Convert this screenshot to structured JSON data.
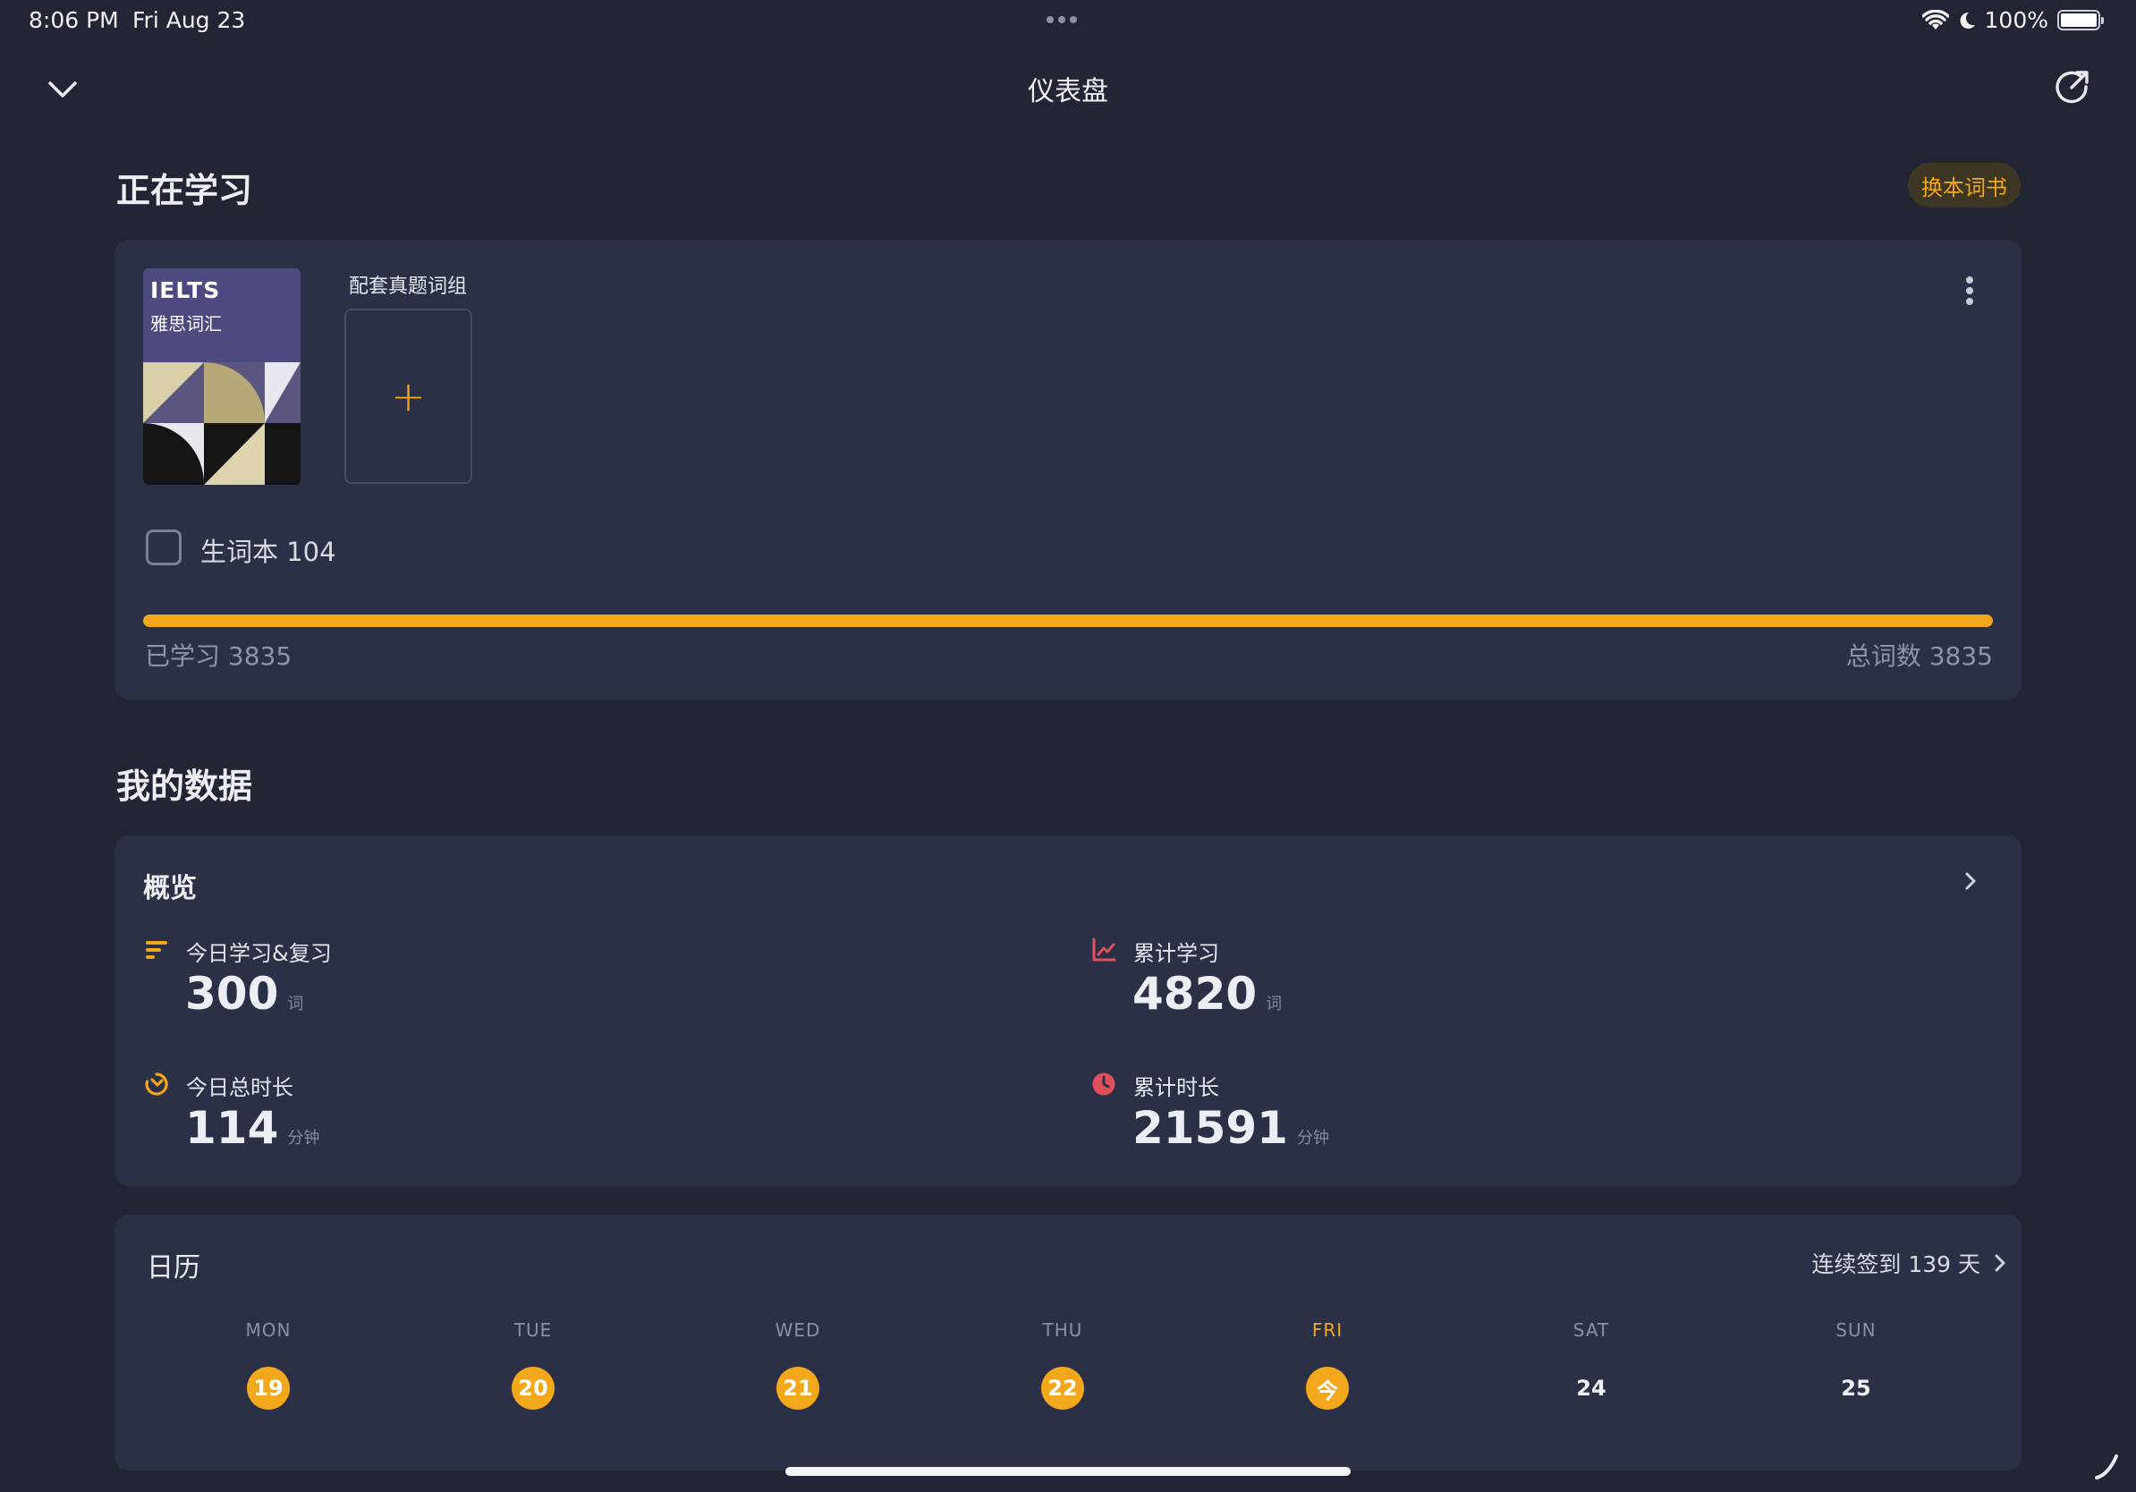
{
  "status_bar": {
    "time": "8:06 PM",
    "date": "Fri Aug 23",
    "battery": "100%"
  },
  "header": {
    "title": "仪表盘"
  },
  "learning": {
    "section_title": "正在学习",
    "switch_book_label": "换本词书",
    "book": {
      "cover_title": "IELTS",
      "cover_subtitle": "雅思词汇"
    },
    "match_group_label": "配套真题词组",
    "add_symbol": "+",
    "vocab_book_label": "生词本 104",
    "progress": {
      "learned_label": "已学习 3835",
      "total_label": "总词数 3835",
      "learned": 3835,
      "total": 3835
    }
  },
  "my_data": {
    "section_title": "我的数据",
    "overview": {
      "title": "概览",
      "stats": [
        {
          "label": "今日学习&复习",
          "value": "300",
          "unit": "词",
          "icon": "bars-icon",
          "color": "#f3a81b"
        },
        {
          "label": "累计学习",
          "value": "4820",
          "unit": "词",
          "icon": "line-chart-icon",
          "color": "#e0505a"
        },
        {
          "label": "今日总时长",
          "value": "114",
          "unit": "分钟",
          "icon": "timer-icon",
          "color": "#f3a81b"
        },
        {
          "label": "累计时长",
          "value": "21591",
          "unit": "分钟",
          "icon": "clock-icon",
          "color": "#e0505a"
        }
      ]
    },
    "calendar": {
      "title": "日历",
      "streak_label": "连续签到 139 天",
      "days": [
        {
          "dow": "MON",
          "date": "19",
          "done": true,
          "today": false
        },
        {
          "dow": "TUE",
          "date": "20",
          "done": true,
          "today": false
        },
        {
          "dow": "WED",
          "date": "21",
          "done": true,
          "today": false
        },
        {
          "dow": "THU",
          "date": "22",
          "done": true,
          "today": false
        },
        {
          "dow": "FRI",
          "date": "今",
          "done": true,
          "today": true
        },
        {
          "dow": "SAT",
          "date": "24",
          "done": false,
          "today": false
        },
        {
          "dow": "SUN",
          "date": "25",
          "done": false,
          "today": false
        }
      ]
    }
  },
  "colors": {
    "background": "#212534",
    "card": "#2b3047",
    "accent": "#f3a81b",
    "red": "#e0505a"
  }
}
